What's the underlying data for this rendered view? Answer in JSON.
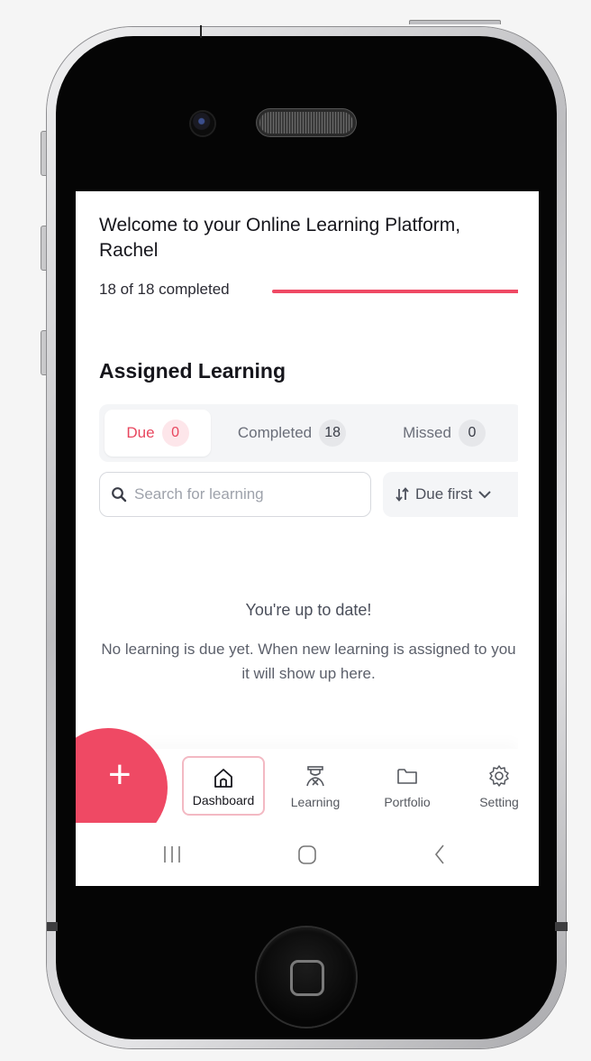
{
  "screen": {
    "welcome_title": "Welcome to your Online Learning Platform, Rachel",
    "progress": {
      "label": "18 of 18 completed",
      "completed": 18,
      "total": 18,
      "fraction": 1.0,
      "color": "#ef4964"
    },
    "section_title": "Assigned Learning",
    "tabs": [
      {
        "label": "Due",
        "count": "0",
        "active": true
      },
      {
        "label": "Completed",
        "count": "18",
        "active": false
      },
      {
        "label": "Missed",
        "count": "0",
        "active": false
      }
    ],
    "search": {
      "placeholder": "Search for learning",
      "value": ""
    },
    "sort": {
      "label": "Due first"
    },
    "empty_state": {
      "title": "You're up to date!",
      "message": "No learning is due yet. When new learning is assigned to you it will show up here."
    },
    "fab": {
      "symbol": "+"
    },
    "bottom_nav": [
      {
        "label": "Dashboard",
        "icon": "home-icon",
        "active": true
      },
      {
        "label": "Learning",
        "icon": "graduate-icon",
        "active": false
      },
      {
        "label": "Portfolio",
        "icon": "folder-icon",
        "active": false
      },
      {
        "label": "Setting",
        "icon": "gear-icon",
        "active": false
      }
    ],
    "android_nav": [
      "recents-icon",
      "home-icon",
      "back-icon"
    ]
  },
  "colors": {
    "accent": "#ef4964",
    "text": "#16161c",
    "muted": "#6a6e79"
  }
}
